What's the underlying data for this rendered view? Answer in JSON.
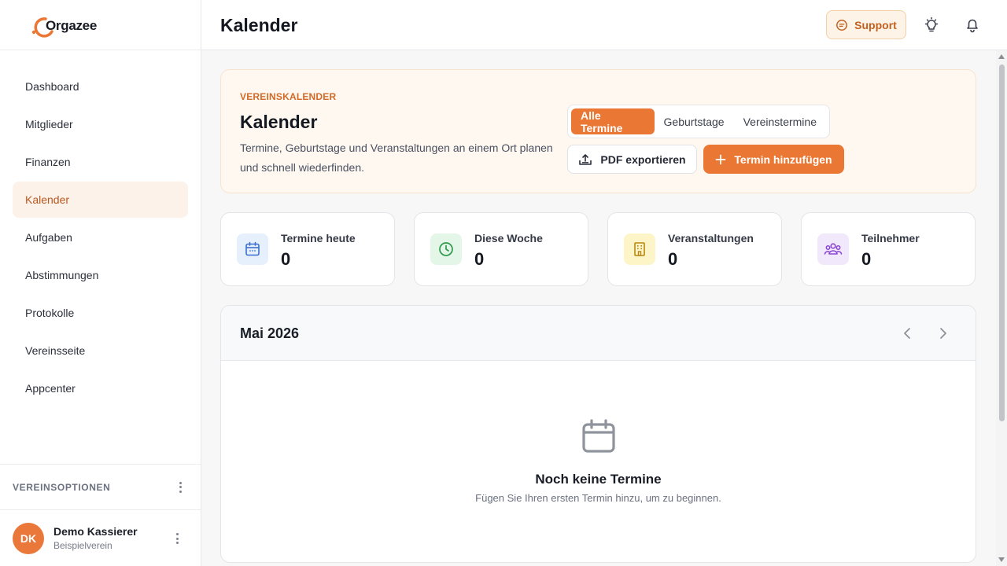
{
  "app": {
    "name": "Orgazee",
    "page_title": "Kalender"
  },
  "sidebar": {
    "items": [
      {
        "label": "Dashboard",
        "active": false
      },
      {
        "label": "Mitglieder",
        "active": false
      },
      {
        "label": "Finanzen",
        "active": false
      },
      {
        "label": "Kalender",
        "active": true
      },
      {
        "label": "Aufgaben",
        "active": false
      },
      {
        "label": "Abstimmungen",
        "active": false
      },
      {
        "label": "Protokolle",
        "active": false
      },
      {
        "label": "Vereinsseite",
        "active": false
      },
      {
        "label": "Appcenter",
        "active": false
      }
    ],
    "options_label": "VEREINSOPTIONEN",
    "user": {
      "initials": "DK",
      "name": "Demo Kassierer",
      "club": "Beispielverein"
    }
  },
  "topbar": {
    "support_label": "Support",
    "icons": [
      "support-chat-icon",
      "lightbulb-icon",
      "bell-icon"
    ]
  },
  "hero": {
    "eyebrow": "VEREINSKALENDER",
    "title": "Kalender",
    "description": "Termine, Geburtstage und Veranstaltungen an einem Ort planen und schnell wiederfinden.",
    "filters": [
      "Alle Termine",
      "Geburtstage",
      "Vereinstermine"
    ],
    "active_filter": "Alle Termine",
    "export_label": "PDF exportieren",
    "add_label": "Termin hinzufügen"
  },
  "stats": [
    {
      "label": "Termine heute",
      "value": "0",
      "icon": "calendar-icon",
      "bg": "#e6effc",
      "color": "#3b6fd1"
    },
    {
      "label": "Diese Woche",
      "value": "0",
      "icon": "clock-icon",
      "bg": "#e4f6e8",
      "color": "#2e9a4c"
    },
    {
      "label": "Veranstaltungen",
      "value": "0",
      "icon": "building-icon",
      "bg": "#fdf4c8",
      "color": "#b8870f"
    },
    {
      "label": "Teilnehmer",
      "value": "0",
      "icon": "users-icon",
      "bg": "#f2e8fc",
      "color": "#8a45d1"
    }
  ],
  "calendar": {
    "month": "Mai 2026",
    "empty_title": "Noch keine Termine",
    "empty_subtitle": "Fügen Sie Ihren ersten Termin hinzu, um zu beginnen."
  },
  "colors": {
    "accent": "#ea7733",
    "accent_text": "#c2611f"
  }
}
